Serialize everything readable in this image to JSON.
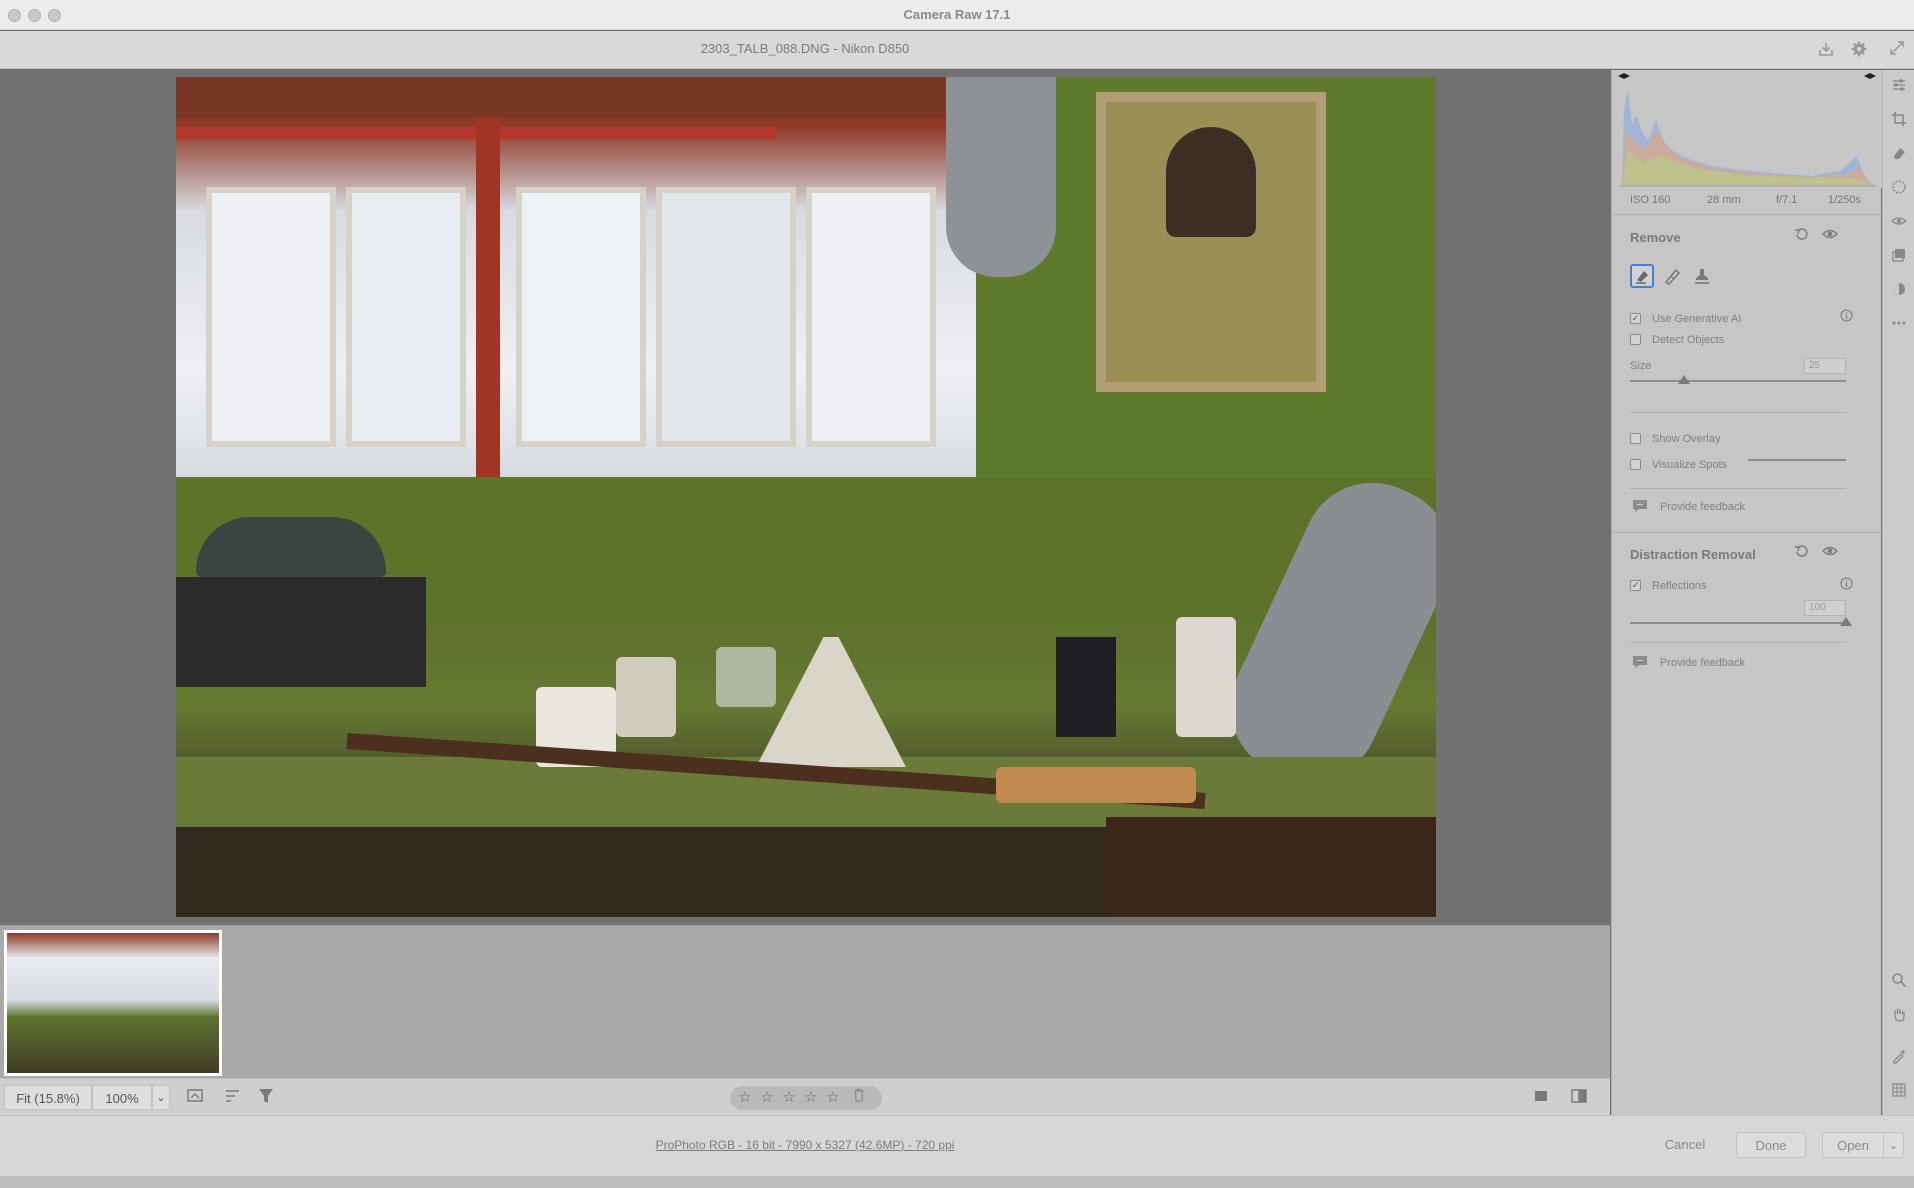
{
  "window": {
    "app_title": "Camera Raw 17.1",
    "file_title": "2303_TALB_088.DNG  -  Nikon D850"
  },
  "toolbar_top": {
    "icons": [
      "save-icon",
      "gear-icon",
      "fullscreen-icon"
    ]
  },
  "histogram": {
    "metadata": [
      "ISO 160",
      "28 mm",
      "f/7.1",
      "1/250s"
    ]
  },
  "remove_panel": {
    "title": "Remove",
    "tools": [
      "remove-brush-icon",
      "heal-icon",
      "clone-stamp-icon"
    ],
    "use_generative_ai": {
      "label": "Use Generative AI",
      "checked": true
    },
    "detect_objects": {
      "label": "Detect Objects",
      "checked": false
    },
    "size": {
      "label": "Size",
      "value": "25",
      "fraction": 0.25
    },
    "show_overlay": {
      "label": "Show Overlay",
      "checked": false
    },
    "visualize_spots": {
      "label": "Visualize Spots",
      "checked": false
    },
    "feedback": "Provide feedback"
  },
  "distraction_panel": {
    "title": "Distraction Removal",
    "reflections": {
      "label": "Reflections",
      "checked": true
    },
    "amount": {
      "value": "100",
      "fraction": 1.0
    },
    "feedback": "Provide feedback"
  },
  "bottombar": {
    "fit_label": "Fit (15.8%)",
    "zoom_label": "100%",
    "zoom_dropdown": "⌄",
    "rating_stars": 5,
    "star_glyph": "☆"
  },
  "footer": {
    "workflow_options": "ProPhoto RGB - 16 bit - 7990 x 5327 (42.6MP) - 720 ppi",
    "cancel": "Cancel",
    "done": "Done",
    "open": "Open",
    "open_dropdown": "⌄"
  },
  "colors": {
    "accent_blue": "#4a7fd4",
    "panel_bg": "#c6c6c6"
  }
}
